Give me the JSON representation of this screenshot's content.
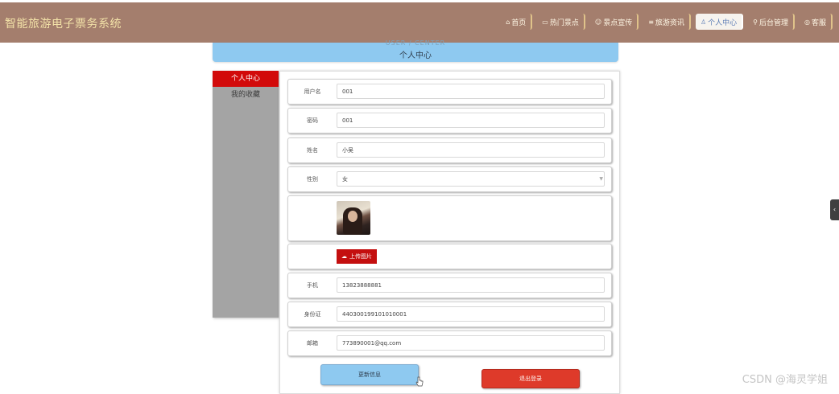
{
  "app": {
    "title": "智能旅游电子票务系统"
  },
  "nav": [
    {
      "icon": "home-icon",
      "glyph": "⌂",
      "label": "首页"
    },
    {
      "icon": "ticket-icon",
      "glyph": "▭",
      "label": "热门景点"
    },
    {
      "icon": "smile-icon",
      "glyph": "☺",
      "label": "景点宣传"
    },
    {
      "icon": "list-icon",
      "glyph": "≡",
      "label": "旅游资讯"
    },
    {
      "icon": "user-icon",
      "glyph": "♙",
      "label": "个人中心"
    },
    {
      "icon": "link-icon",
      "glyph": "⚲",
      "label": "后台管理"
    },
    {
      "icon": "support-icon",
      "glyph": "◎",
      "label": "客服"
    }
  ],
  "header": {
    "ghost": "USER / CENTER",
    "title": "个人中心"
  },
  "sidebar": {
    "items": [
      {
        "label": "个人中心"
      },
      {
        "label": "我的收藏"
      }
    ]
  },
  "form": {
    "username": {
      "label": "用户名",
      "value": "001"
    },
    "password": {
      "label": "密码",
      "value": "001"
    },
    "name": {
      "label": "姓名",
      "value": "小吴"
    },
    "gender": {
      "label": "性别",
      "value": "女"
    },
    "upload": {
      "label": "上传图片"
    },
    "phone": {
      "label": "手机",
      "value": "13823888881"
    },
    "idcard": {
      "label": "身份证",
      "value": "440300199101010001"
    },
    "email": {
      "label": "邮箱",
      "value": "773890001@qq.com"
    }
  },
  "actions": {
    "save": "更新信息",
    "logout": "退出登录"
  },
  "watermark": "CSDN @海灵学姐",
  "colors": {
    "topbar": "#a47e6d",
    "brand_text": "#f3e2a8",
    "header_banner": "#8ec9f0",
    "sidebar_active": "#d20a0a",
    "logout_button": "#de3a2a"
  }
}
